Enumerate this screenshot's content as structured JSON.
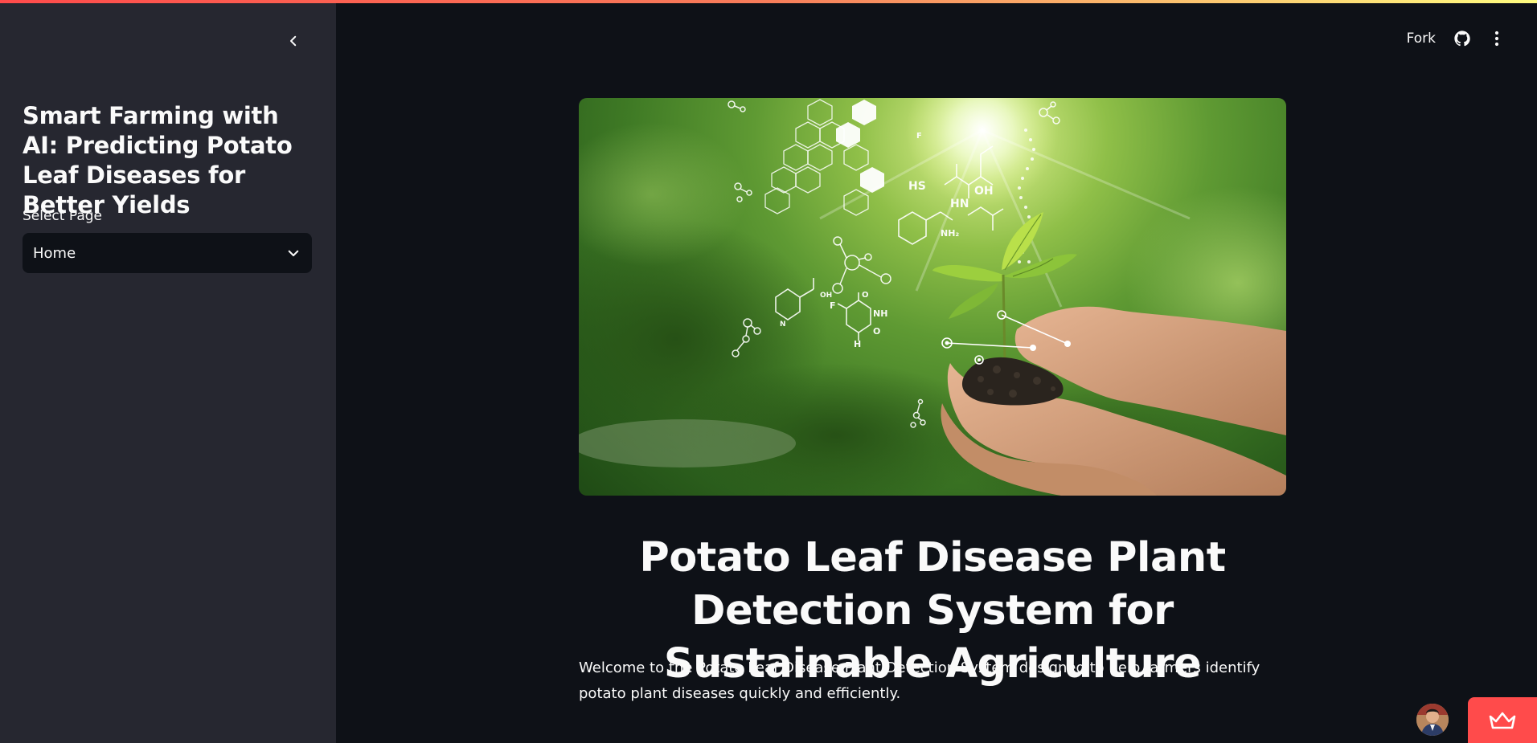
{
  "sidebar": {
    "title": "Smart Farming with AI: Predicting Potato Leaf Diseases for Better Yields",
    "select_label": "Select Page",
    "select_value": "Home",
    "collapse_icon": "chevron-left-icon"
  },
  "toolbar": {
    "fork_label": "Fork",
    "github_icon": "github-icon",
    "menu_icon": "kebab-menu-icon"
  },
  "main": {
    "title": "Potato Leaf Disease Plant Detection System for Sustainable Agriculture",
    "intro": "Welcome to the Potato Leaf Disease Plant Detection System designed to help farmers identify potato plant diseases quickly and efficiently."
  },
  "colors": {
    "app_background": "#0e1117",
    "sidebar_background": "#262730",
    "accent": "#ff4b4b"
  }
}
